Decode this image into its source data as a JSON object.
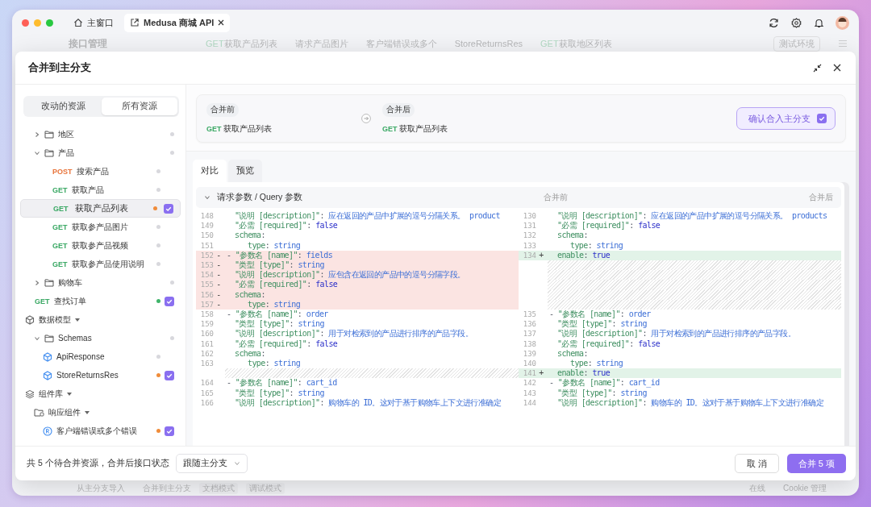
{
  "window": {
    "tabs": [
      {
        "label": "主窗口",
        "selected": false,
        "kind": "home"
      },
      {
        "label": "Medusa 商城 API",
        "selected": true,
        "kind": "project"
      }
    ]
  },
  "background_app": {
    "title": "接口管理",
    "tabs": [
      {
        "method": "GET",
        "label": "获取产品列表"
      },
      {
        "label": "请求产品图片"
      },
      {
        "label": "客户端错误或多个"
      },
      {
        "label": "StoreReturnsRes"
      },
      {
        "method": "GET",
        "label": "获取地区列表"
      }
    ],
    "environment": "测试环境",
    "footer_left": [
      "从主分支导入",
      "合并到主分支"
    ],
    "modes": [
      "文档模式",
      "调试模式"
    ],
    "footer_right": [
      "在线",
      "Cookie 管理"
    ]
  },
  "dialog": {
    "title": "合并到主分支",
    "resource_tabs": [
      {
        "label": "改动的资源",
        "selected": false
      },
      {
        "label": "所有资源",
        "selected": true
      }
    ],
    "tree": [
      {
        "kind": "folder-contents",
        "children": [
          {
            "kind": "folder",
            "label": "地区",
            "expanded": false,
            "selected": false,
            "color": "#d8d8dd"
          },
          {
            "kind": "folder",
            "label": "产品",
            "expanded": true,
            "selected": false,
            "color": "#d8d8dd",
            "children": [
              {
                "kind": "endpoint",
                "method": "POST",
                "label": "搜索产品",
                "selected": false,
                "checked": false,
                "color": "#d8d8dd"
              },
              {
                "kind": "endpoint",
                "method": "GET",
                "label": "获取产品",
                "selected": false,
                "checked": false,
                "color": "#d8d8dd"
              },
              {
                "kind": "endpoint",
                "method": "GET",
                "label": "获取产品列表",
                "selected": true,
                "checked": true,
                "color": "#f08c3a"
              },
              {
                "kind": "endpoint",
                "method": "GET",
                "label": "获取参产品图片",
                "selected": false,
                "checked": false,
                "color": "#d8d8dd"
              },
              {
                "kind": "endpoint",
                "method": "GET",
                "label": "获取参产品视频",
                "selected": false,
                "checked": false,
                "color": "#d8d8dd"
              },
              {
                "kind": "endpoint",
                "method": "GET",
                "label": "获取参产品使用说明",
                "selected": false,
                "checked": false,
                "color": "#d8d8dd"
              }
            ]
          },
          {
            "kind": "folder",
            "label": "购物车",
            "expanded": false,
            "selected": false,
            "color": "#d8d8dd"
          }
        ]
      },
      {
        "kind": "endpoint",
        "method": "GET",
        "label": "查找订单",
        "selected": false,
        "checked": true,
        "color": "#3fb46a"
      },
      {
        "kind": "model-section",
        "label": "数据模型",
        "selected": false,
        "children": [
          {
            "kind": "folder",
            "label": "Schemas",
            "expanded": true,
            "selected": false,
            "color": "#d8d8dd",
            "children": [
              {
                "kind": "schema",
                "label": "ApiResponse",
                "selected": false,
                "checked": false,
                "color": "#d8d8dd"
              },
              {
                "kind": "schema",
                "label": "StoreReturnsRes",
                "selected": false,
                "checked": true,
                "color": "#f08c3a"
              }
            ]
          }
        ]
      },
      {
        "kind": "component-section",
        "label": "组件库",
        "selected": false,
        "children": [
          {
            "kind": "component-folder",
            "label": "响应组件",
            "selected": false,
            "children": [
              {
                "kind": "component",
                "label": "客户端错误或多个错误",
                "selected": false,
                "checked": true,
                "color": "#f08c3a"
              }
            ]
          }
        ]
      }
    ],
    "before": {
      "label": "合并前",
      "method": "GET",
      "name": "获取产品列表"
    },
    "after": {
      "label": "合并后",
      "method": "GET",
      "name": "获取产品列表"
    },
    "confirm_button": {
      "label": "确认合入主分支",
      "checked": true
    },
    "view_tabs": [
      {
        "label": "对比",
        "selected": true
      },
      {
        "label": "预览",
        "selected": false
      }
    ],
    "section": {
      "title": "请求参数 / Query 参数",
      "expanded": true,
      "left_label": "合并前",
      "right_label": "合并后"
    },
    "diff_rows": [
      {
        "left": {
          "num": "148",
          "kind": "field",
          "removed": false,
          "added": false,
          "tokens": [
            {
              "kind": "key",
              "text": "\"说明 [description]\""
            },
            {
              "kind": "punct",
              "text": ": "
            },
            {
              "kind": "str",
              "text": "应在返回的产品中扩展的逗号分隔关系。 product"
            }
          ]
        },
        "right": {
          "num": "130",
          "kind": "field",
          "removed": false,
          "added": false,
          "tokens": [
            {
              "kind": "key",
              "text": "\"说明 [description]\""
            },
            {
              "kind": "punct",
              "text": ": "
            },
            {
              "kind": "str",
              "text": "应在返回的产品中扩展的逗号分隔关系。 products"
            }
          ]
        }
      },
      {
        "left": {
          "num": "149",
          "kind": "field",
          "removed": false,
          "added": false,
          "tokens": [
            {
              "kind": "key",
              "text": "\"必需 [required]\""
            },
            {
              "kind": "punct",
              "text": ": "
            },
            {
              "kind": "bool",
              "text": "false"
            }
          ]
        },
        "right": {
          "num": "131",
          "kind": "field",
          "removed": false,
          "added": false,
          "tokens": [
            {
              "kind": "key",
              "text": "\"必需 [required]\""
            },
            {
              "kind": "punct",
              "text": ": "
            },
            {
              "kind": "bool",
              "text": "false"
            }
          ]
        }
      },
      {
        "left": {
          "num": "150",
          "kind": "field",
          "removed": false,
          "added": false,
          "tokens": [
            {
              "kind": "key",
              "text": "schema"
            },
            {
              "kind": "punct",
              "text": ":"
            }
          ]
        },
        "right": {
          "num": "132",
          "kind": "field",
          "removed": false,
          "added": false,
          "tokens": [
            {
              "kind": "key",
              "text": "schema"
            },
            {
              "kind": "punct",
              "text": ":"
            }
          ]
        }
      },
      {
        "left": {
          "num": "151",
          "kind": "nested",
          "removed": false,
          "added": false,
          "tokens": [
            {
              "kind": "key",
              "text": "type"
            },
            {
              "kind": "punct",
              "text": ": "
            },
            {
              "kind": "str",
              "text": "string"
            }
          ]
        },
        "right": {
          "num": "133",
          "kind": "nested",
          "removed": false,
          "added": false,
          "tokens": [
            {
              "kind": "key",
              "text": "type"
            },
            {
              "kind": "punct",
              "text": ": "
            },
            {
              "kind": "str",
              "text": "string"
            }
          ]
        }
      },
      {
        "left": {
          "num": "152",
          "kind": "item",
          "removed": true,
          "added": false,
          "sign": "-",
          "tokens": [
            {
              "kind": "punct",
              "text": "- "
            },
            {
              "kind": "key",
              "text": "\"参数名 [name]\""
            },
            {
              "kind": "punct",
              "text": ": "
            },
            {
              "kind": "str",
              "text": "fields"
            }
          ]
        },
        "right": {
          "num": "134",
          "kind": "field",
          "removed": false,
          "added": true,
          "sign": "+",
          "tokens": [
            {
              "kind": "key",
              "text": "enable"
            },
            {
              "kind": "punct",
              "text": ": "
            },
            {
              "kind": "bool",
              "text": "true"
            }
          ]
        }
      },
      {
        "left": {
          "num": "153",
          "kind": "field",
          "removed": true,
          "added": false,
          "sign": "-",
          "tokens": [
            {
              "kind": "key",
              "text": "\"类型 [type]\""
            },
            {
              "kind": "punct",
              "text": ": "
            },
            {
              "kind": "str",
              "text": "string"
            }
          ]
        },
        "right": {
          "kind": "filler"
        }
      },
      {
        "left": {
          "num": "154",
          "kind": "field",
          "removed": true,
          "added": false,
          "sign": "-",
          "tokens": [
            {
              "kind": "key",
              "text": "\"说明 [description]\""
            },
            {
              "kind": "punct",
              "text": ": "
            },
            {
              "kind": "str",
              "text": "应包含在返回的产品中的逗号分隔字段。"
            }
          ]
        },
        "right": {
          "kind": "filler"
        }
      },
      {
        "left": {
          "num": "155",
          "kind": "field",
          "removed": true,
          "added": false,
          "sign": "-",
          "tokens": [
            {
              "kind": "key",
              "text": "\"必需 [required]\""
            },
            {
              "kind": "punct",
              "text": ": "
            },
            {
              "kind": "bool",
              "text": "false"
            }
          ]
        },
        "right": {
          "kind": "filler"
        }
      },
      {
        "left": {
          "num": "156",
          "kind": "field",
          "removed": true,
          "added": false,
          "sign": "-",
          "tokens": [
            {
              "kind": "key",
              "text": "schema"
            },
            {
              "kind": "punct",
              "text": ":"
            }
          ]
        },
        "right": {
          "kind": "filler"
        }
      },
      {
        "left": {
          "num": "157",
          "kind": "nested",
          "removed": true,
          "added": false,
          "sign": "-",
          "tokens": [
            {
              "kind": "key",
              "text": "type"
            },
            {
              "kind": "punct",
              "text": ": "
            },
            {
              "kind": "str",
              "text": "string"
            }
          ]
        },
        "right": {
          "kind": "filler"
        }
      },
      {
        "left": {
          "num": "158",
          "kind": "item",
          "removed": false,
          "added": false,
          "tokens": [
            {
              "kind": "punct",
              "text": "- "
            },
            {
              "kind": "key",
              "text": "\"参数名 [name]\""
            },
            {
              "kind": "punct",
              "text": ": "
            },
            {
              "kind": "str",
              "text": "order"
            }
          ]
        },
        "right": {
          "num": "135",
          "kind": "item",
          "removed": false,
          "added": false,
          "tokens": [
            {
              "kind": "punct",
              "text": "- "
            },
            {
              "kind": "key",
              "text": "\"参数名 [name]\""
            },
            {
              "kind": "punct",
              "text": ": "
            },
            {
              "kind": "str",
              "text": "order"
            }
          ]
        }
      },
      {
        "left": {
          "num": "159",
          "kind": "field",
          "removed": false,
          "added": false,
          "tokens": [
            {
              "kind": "key",
              "text": "\"类型 [type]\""
            },
            {
              "kind": "punct",
              "text": ": "
            },
            {
              "kind": "str",
              "text": "string"
            }
          ]
        },
        "right": {
          "num": "136",
          "kind": "field",
          "removed": false,
          "added": false,
          "tokens": [
            {
              "kind": "key",
              "text": "\"类型 [type]\""
            },
            {
              "kind": "punct",
              "text": ": "
            },
            {
              "kind": "str",
              "text": "string"
            }
          ]
        }
      },
      {
        "left": {
          "num": "160",
          "kind": "field",
          "removed": false,
          "added": false,
          "tokens": [
            {
              "kind": "key",
              "text": "\"说明 [description]\""
            },
            {
              "kind": "punct",
              "text": ": "
            },
            {
              "kind": "str",
              "text": "用于对检索到的产品进行排序的产品字段。"
            }
          ]
        },
        "right": {
          "num": "137",
          "kind": "field",
          "removed": false,
          "added": false,
          "tokens": [
            {
              "kind": "key",
              "text": "\"说明 [description]\""
            },
            {
              "kind": "punct",
              "text": ": "
            },
            {
              "kind": "str",
              "text": "用于对检索到的产品进行排序的产品字段。"
            }
          ]
        }
      },
      {
        "left": {
          "num": "161",
          "kind": "field",
          "removed": false,
          "added": false,
          "tokens": [
            {
              "kind": "key",
              "text": "\"必需 [required]\""
            },
            {
              "kind": "punct",
              "text": ": "
            },
            {
              "kind": "bool",
              "text": "false"
            }
          ]
        },
        "right": {
          "num": "138",
          "kind": "field",
          "removed": false,
          "added": false,
          "tokens": [
            {
              "kind": "key",
              "text": "\"必需 [required]\""
            },
            {
              "kind": "punct",
              "text": ": "
            },
            {
              "kind": "bool",
              "text": "false"
            }
          ]
        }
      },
      {
        "left": {
          "num": "162",
          "kind": "field",
          "removed": false,
          "added": false,
          "tokens": [
            {
              "kind": "key",
              "text": "schema"
            },
            {
              "kind": "punct",
              "text": ":"
            }
          ]
        },
        "right": {
          "num": "139",
          "kind": "field",
          "removed": false,
          "added": false,
          "tokens": [
            {
              "kind": "key",
              "text": "schema"
            },
            {
              "kind": "punct",
              "text": ":"
            }
          ]
        }
      },
      {
        "left": {
          "num": "163",
          "kind": "nested",
          "removed": false,
          "added": false,
          "tokens": [
            {
              "kind": "key",
              "text": "type"
            },
            {
              "kind": "punct",
              "text": ": "
            },
            {
              "kind": "str",
              "text": "string"
            }
          ]
        },
        "right": {
          "num": "140",
          "kind": "nested",
          "removed": false,
          "added": false,
          "tokens": [
            {
              "kind": "key",
              "text": "type"
            },
            {
              "kind": "punct",
              "text": ": "
            },
            {
              "kind": "str",
              "text": "string"
            }
          ]
        }
      },
      {
        "left": {
          "kind": "filler"
        },
        "right": {
          "num": "141",
          "kind": "field",
          "removed": false,
          "added": true,
          "sign": "+",
          "tokens": [
            {
              "kind": "key",
              "text": "enable"
            },
            {
              "kind": "punct",
              "text": ": "
            },
            {
              "kind": "bool",
              "text": "true"
            }
          ]
        }
      },
      {
        "left": {
          "num": "164",
          "kind": "item",
          "removed": false,
          "added": false,
          "tokens": [
            {
              "kind": "punct",
              "text": "- "
            },
            {
              "kind": "key",
              "text": "\"参数名 [name]\""
            },
            {
              "kind": "punct",
              "text": ": "
            },
            {
              "kind": "str",
              "text": "cart_id"
            }
          ]
        },
        "right": {
          "num": "142",
          "kind": "item",
          "removed": false,
          "added": false,
          "tokens": [
            {
              "kind": "punct",
              "text": "- "
            },
            {
              "kind": "key",
              "text": "\"参数名 [name]\""
            },
            {
              "kind": "punct",
              "text": ": "
            },
            {
              "kind": "str",
              "text": "cart_id"
            }
          ]
        }
      },
      {
        "left": {
          "num": "165",
          "kind": "field",
          "removed": false,
          "added": false,
          "tokens": [
            {
              "kind": "key",
              "text": "\"类型 [type]\""
            },
            {
              "kind": "punct",
              "text": ": "
            },
            {
              "kind": "str",
              "text": "string"
            }
          ]
        },
        "right": {
          "num": "143",
          "kind": "field",
          "removed": false,
          "added": false,
          "tokens": [
            {
              "kind": "key",
              "text": "\"类型 [type]\""
            },
            {
              "kind": "punct",
              "text": ": "
            },
            {
              "kind": "str",
              "text": "string"
            }
          ]
        }
      },
      {
        "left": {
          "num": "166",
          "kind": "field",
          "removed": false,
          "added": false,
          "tokens": [
            {
              "kind": "key",
              "text": "\"说明 [description]\""
            },
            {
              "kind": "punct",
              "text": ": "
            },
            {
              "kind": "str",
              "text": "购物车的 ID。这对于基于购物车上下文进行准确定"
            }
          ]
        },
        "right": {
          "num": "144",
          "kind": "field",
          "removed": false,
          "added": false,
          "tokens": [
            {
              "kind": "key",
              "text": "\"说明 [description]\""
            },
            {
              "kind": "punct",
              "text": ": "
            },
            {
              "kind": "str",
              "text": "购物车的 ID。这对于基于购物车上下文进行准确定"
            }
          ]
        }
      }
    ],
    "summary": "共 5 个待合并资源，合并后接口状态",
    "status_select": "跟随主分支",
    "cancel_button": "取 消",
    "merge_button": "合并 5 项"
  }
}
